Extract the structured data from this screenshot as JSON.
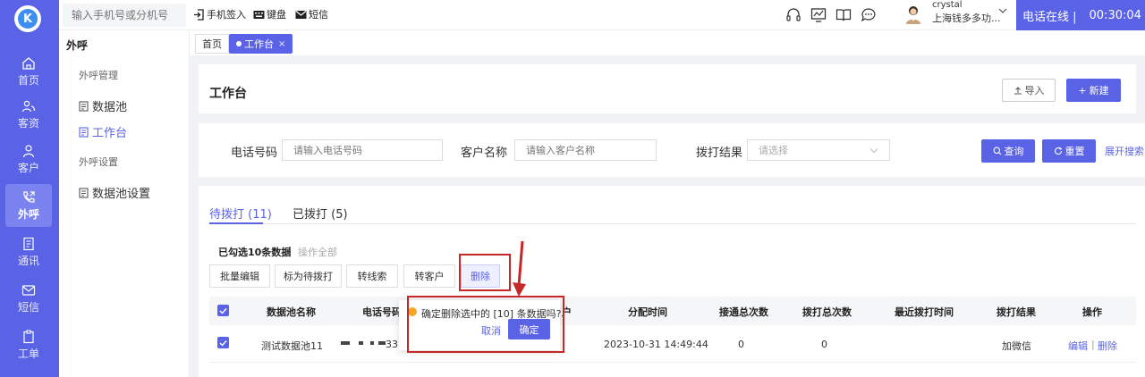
{
  "colors": {
    "accent": "#5a63e6",
    "annotation": "#c62828",
    "warning": "#f5a623"
  },
  "logo": {
    "letter": "K"
  },
  "leftnav": [
    {
      "label": "首页",
      "icon": "home-icon"
    },
    {
      "label": "客资",
      "icon": "users-icon"
    },
    {
      "label": "客户",
      "icon": "person-icon"
    },
    {
      "label": "外呼",
      "icon": "phone-out-icon"
    },
    {
      "label": "通讯",
      "icon": "contacts-icon"
    },
    {
      "label": "短信",
      "icon": "message-icon"
    },
    {
      "label": "工单",
      "icon": "clipboard-icon"
    }
  ],
  "topbar": {
    "search_placeholder": "输入手机号或分机号",
    "phone_signin": "手机签入",
    "keyboard": "键盘",
    "sms": "短信",
    "user_name": "crystal",
    "user_org": "上海钱多多功...",
    "status": "电话在线 |",
    "timer": "00:30:04"
  },
  "subnav": {
    "module": "外呼",
    "group1": "外呼管理",
    "item1": "数据池",
    "item2": "工作台",
    "group2": "外呼设置",
    "item3": "数据池设置"
  },
  "tabs": {
    "home": "首页",
    "active": "工作台"
  },
  "header": {
    "title": "工作台",
    "import": "导入",
    "create": "新建"
  },
  "filters": {
    "phone_label": "电话号码",
    "phone_placeholder": "请输入电话号码",
    "name_label": "客户名称",
    "name_placeholder": "请输入客户名称",
    "result_label": "拨打结果",
    "result_placeholder": "请选择",
    "query": "查询",
    "reset": "重置",
    "expand": "展开搜索"
  },
  "listtabs": {
    "pending": "待拨打 (11)",
    "done": "已拨打 (5)"
  },
  "selection": {
    "info": "已勾选10条数据",
    "sep": "|",
    "op_all": "操作全部"
  },
  "actions": {
    "batch_edit": "批量编辑",
    "mark_pending": "标为待拨打",
    "to_lead": "转线索",
    "to_customer": "转客户",
    "delete": "删除"
  },
  "table": {
    "headers": [
      "数据池名称",
      "电话号码",
      "户",
      "分配时间",
      "接通总次数",
      "拨打总次数",
      "最近拨打时间",
      "拨打结果",
      "操作"
    ],
    "row": {
      "pool": "测试数据池11",
      "phone_tail": "33",
      "time": "2023-10-31 14:49:44",
      "connected": "0",
      "dialed": "0",
      "result": "加微信",
      "edit": "编辑",
      "op_sep": "|",
      "delete": "删除"
    }
  },
  "popconfirm": {
    "text": "确定删除选中的 [10] 条数据吗?",
    "cancel": "取消",
    "ok": "确定"
  }
}
